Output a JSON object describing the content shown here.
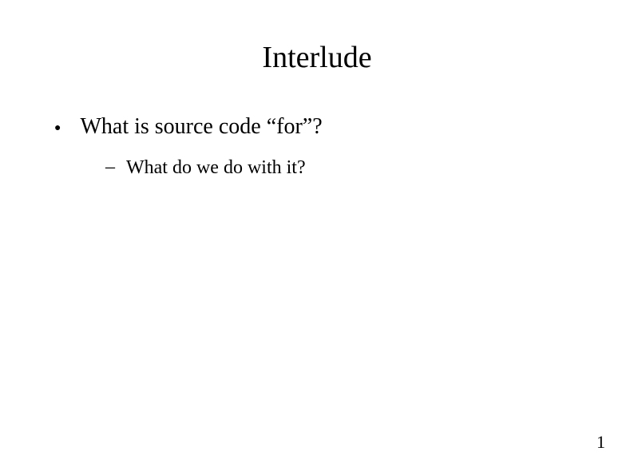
{
  "title": "Interlude",
  "bullets": [
    {
      "text": "What is source code “for”?",
      "subitems": [
        "What do we do with it?"
      ]
    }
  ],
  "page_number": "1"
}
